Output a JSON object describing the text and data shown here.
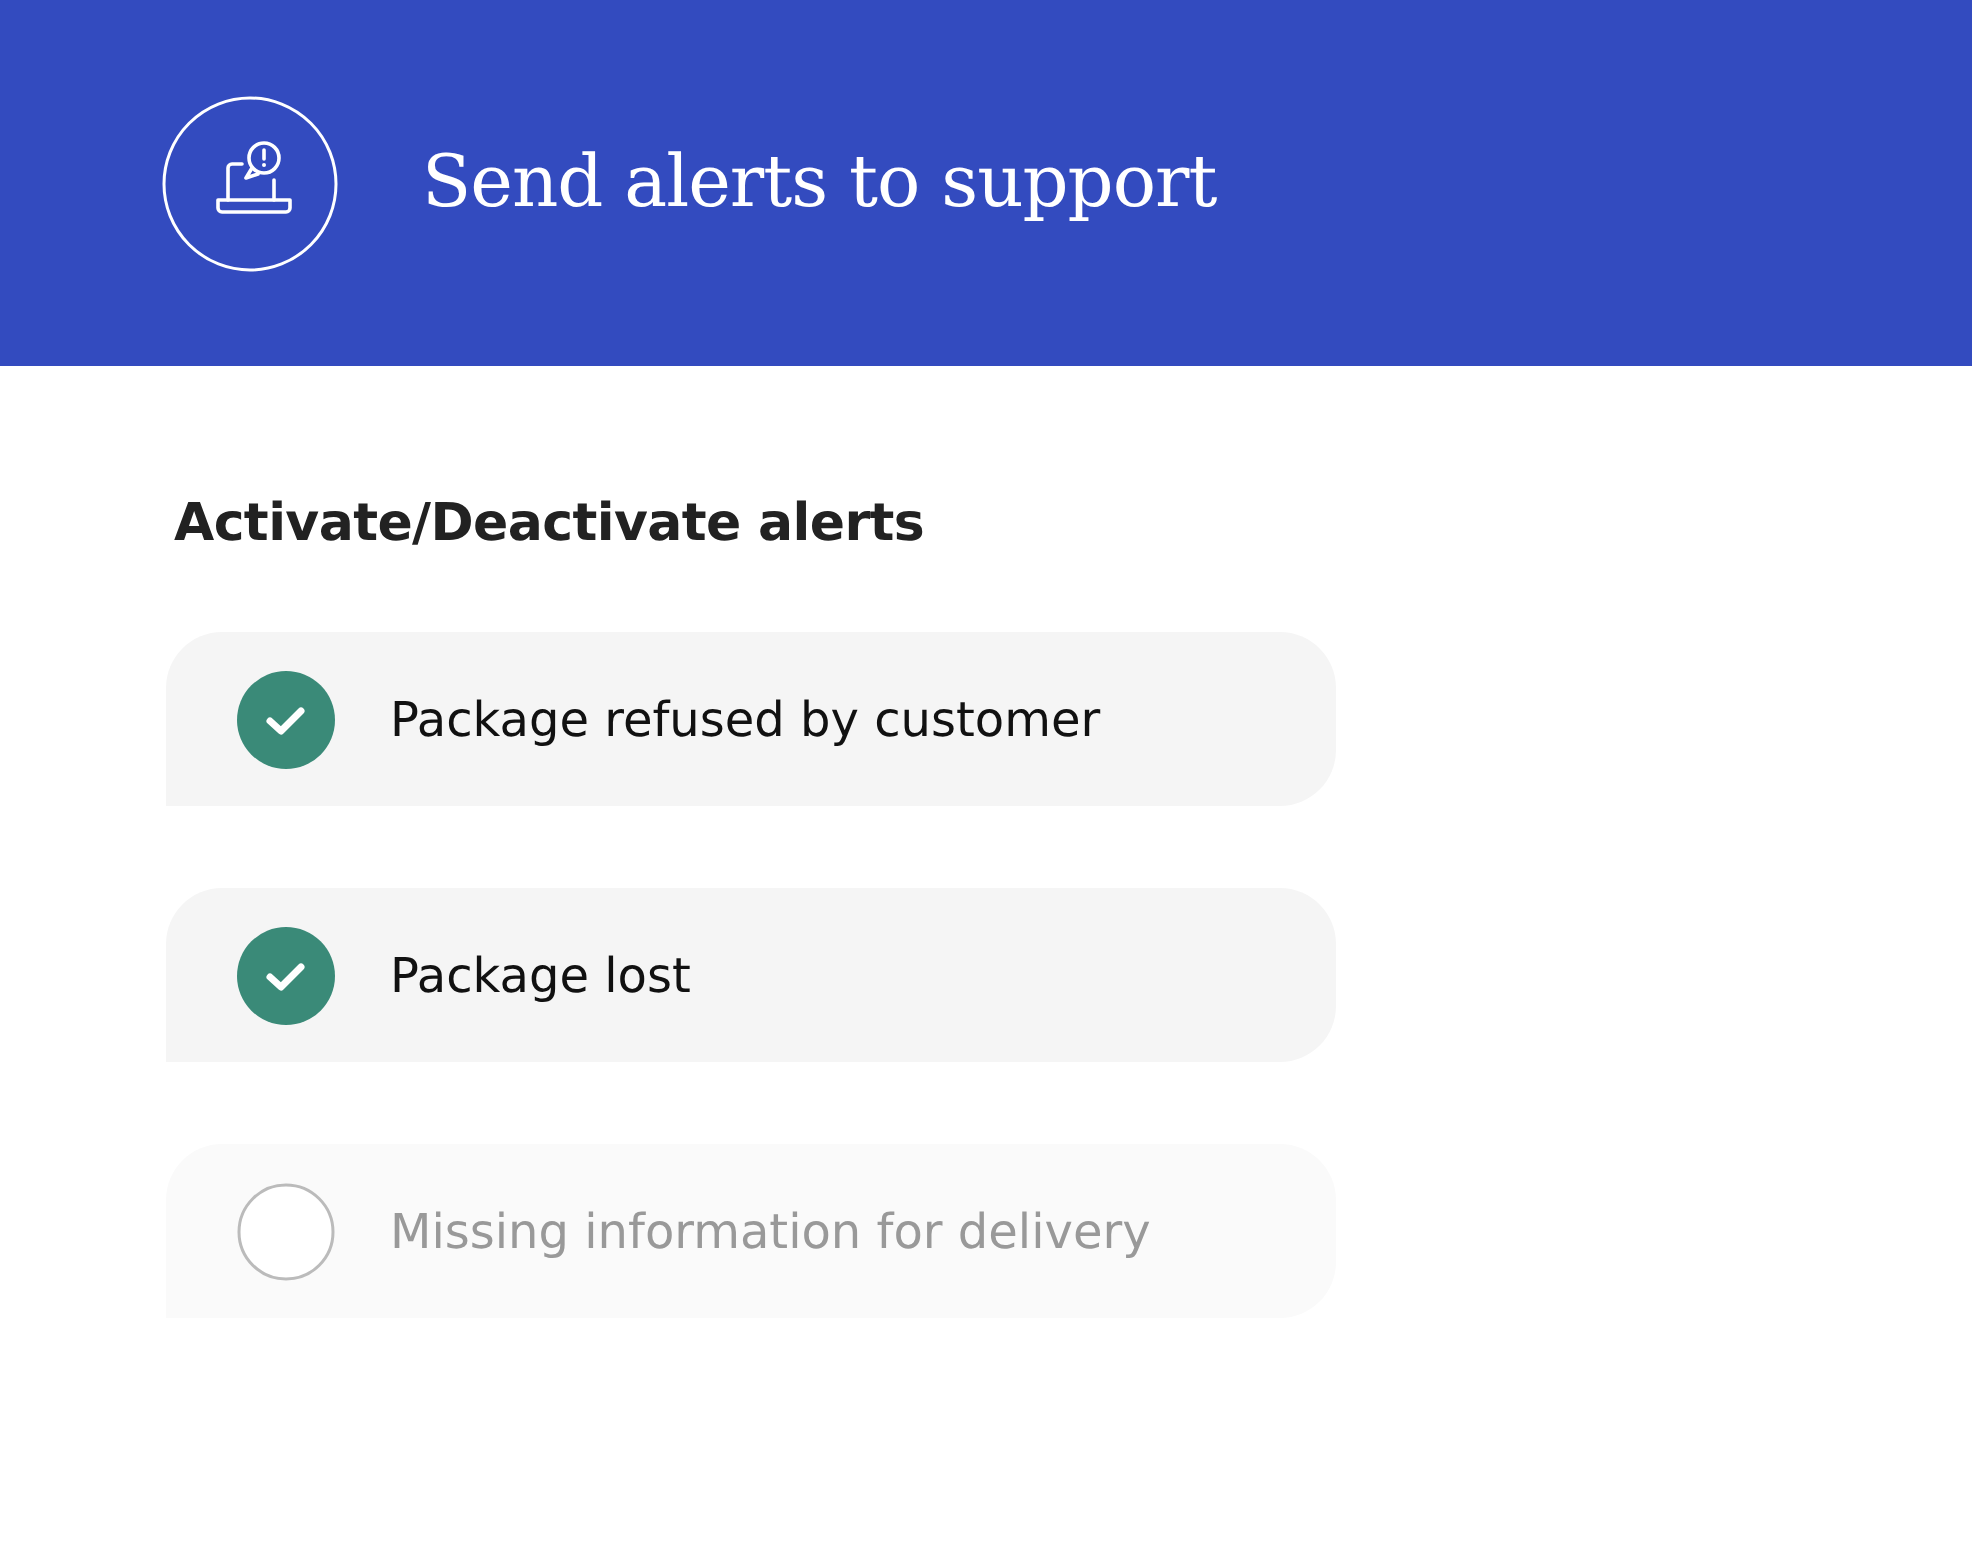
{
  "header": {
    "title": "Send alerts to support"
  },
  "section": {
    "title": "Activate/Deactivate alerts"
  },
  "alerts": [
    {
      "label": "Package refused by customer",
      "checked": true
    },
    {
      "label": "Package lost",
      "checked": true
    },
    {
      "label": "Missing information for delivery",
      "checked": false
    }
  ]
}
